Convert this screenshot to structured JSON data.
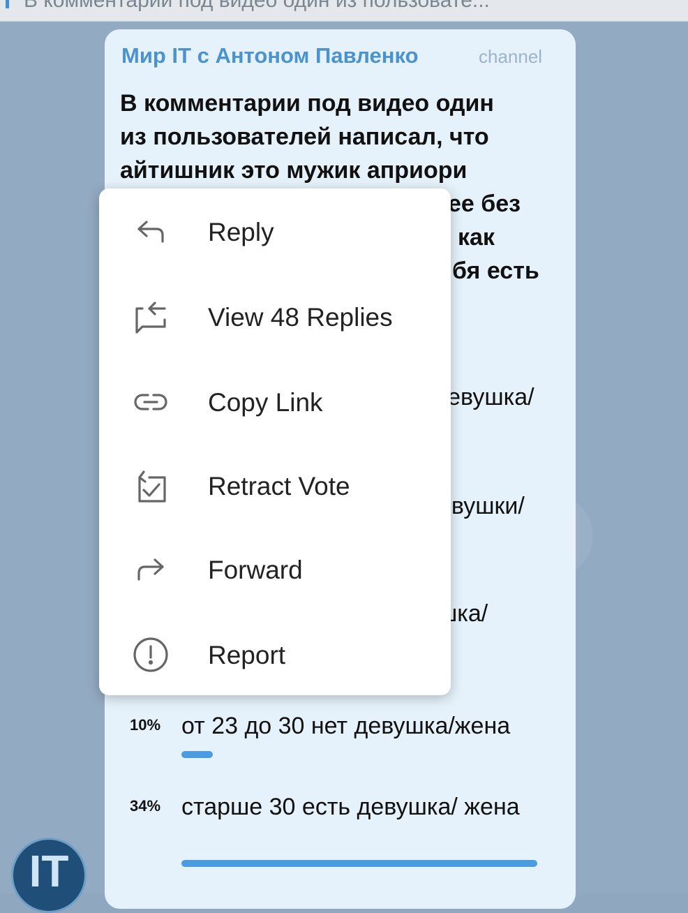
{
  "pinned": {
    "text": "В комментарии под видео один из пользовате..."
  },
  "message": {
    "channel_name": "Мир IT с Антоном Павленко",
    "channel_badge": "channel",
    "text_lines": [
      "В комментарии под видео один",
      "из пользователей написал, что",
      "айтишник это мужик априори",
      "ее без",
      "как",
      "бя есть",
      "цевушка/",
      "евушки/",
      "шка/"
    ]
  },
  "poll": {
    "options": [
      {
        "percent_label": "10%",
        "percent": 10,
        "label": "от 23 до 30 нет девушка/жена"
      },
      {
        "percent_label": "34%",
        "percent": 34,
        "label": "старше 30 есть девушка/ жена"
      }
    ]
  },
  "avatar": {
    "text": "IT"
  },
  "context_menu": {
    "items": [
      {
        "label": "Reply",
        "icon": "reply-icon"
      },
      {
        "label": "View 48 Replies",
        "icon": "replies-icon"
      },
      {
        "label": "Copy Link",
        "icon": "link-icon"
      },
      {
        "label": "Retract Vote",
        "icon": "retract-vote-icon"
      },
      {
        "label": "Forward",
        "icon": "forward-icon"
      },
      {
        "label": "Report",
        "icon": "report-icon"
      }
    ]
  },
  "colors": {
    "accent": "#4a93cf",
    "poll_bar": "#4a9be0",
    "bubble": "#e6f2fb"
  }
}
